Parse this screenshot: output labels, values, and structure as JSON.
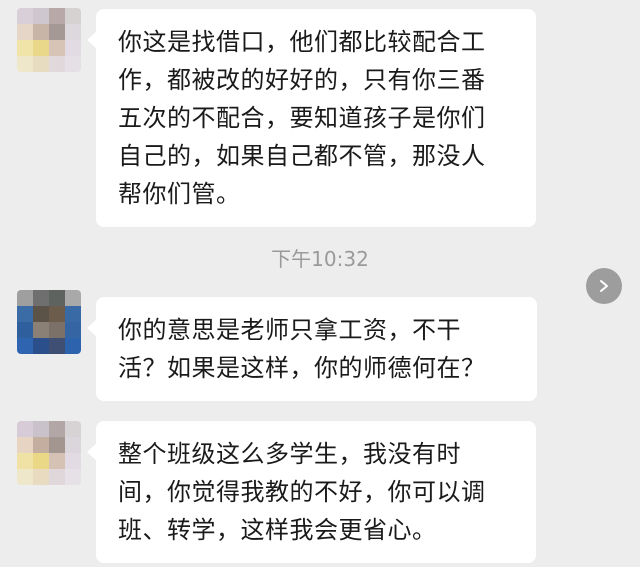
{
  "messages": [
    {
      "lines": [
        "你这是找借口，他们都比较配合工",
        "作，都被改的好好的，只有你三番",
        "五次的不配合，要知道孩子是你们",
        "自己的，如果自己都不管，那没人",
        "帮你们管。"
      ]
    },
    {
      "lines": [
        "你的意思是老师只拿工资，不干",
        "活？如果是这样，你的师德何在？"
      ]
    },
    {
      "lines": [
        "整个班级这么多学生，我没有时",
        "间，你觉得我教的不好，你可以调",
        "班、转学，这样我会更省心。"
      ]
    }
  ],
  "timestamp": "下午10:32",
  "colors": {
    "background": "#ededed",
    "bubble": "#ffffff",
    "text": "#1a1a1a",
    "timestamp": "#9a9a9a",
    "nav_button": "#9d9d9d"
  },
  "icons": {
    "nav_next": "chevron-right-icon"
  }
}
